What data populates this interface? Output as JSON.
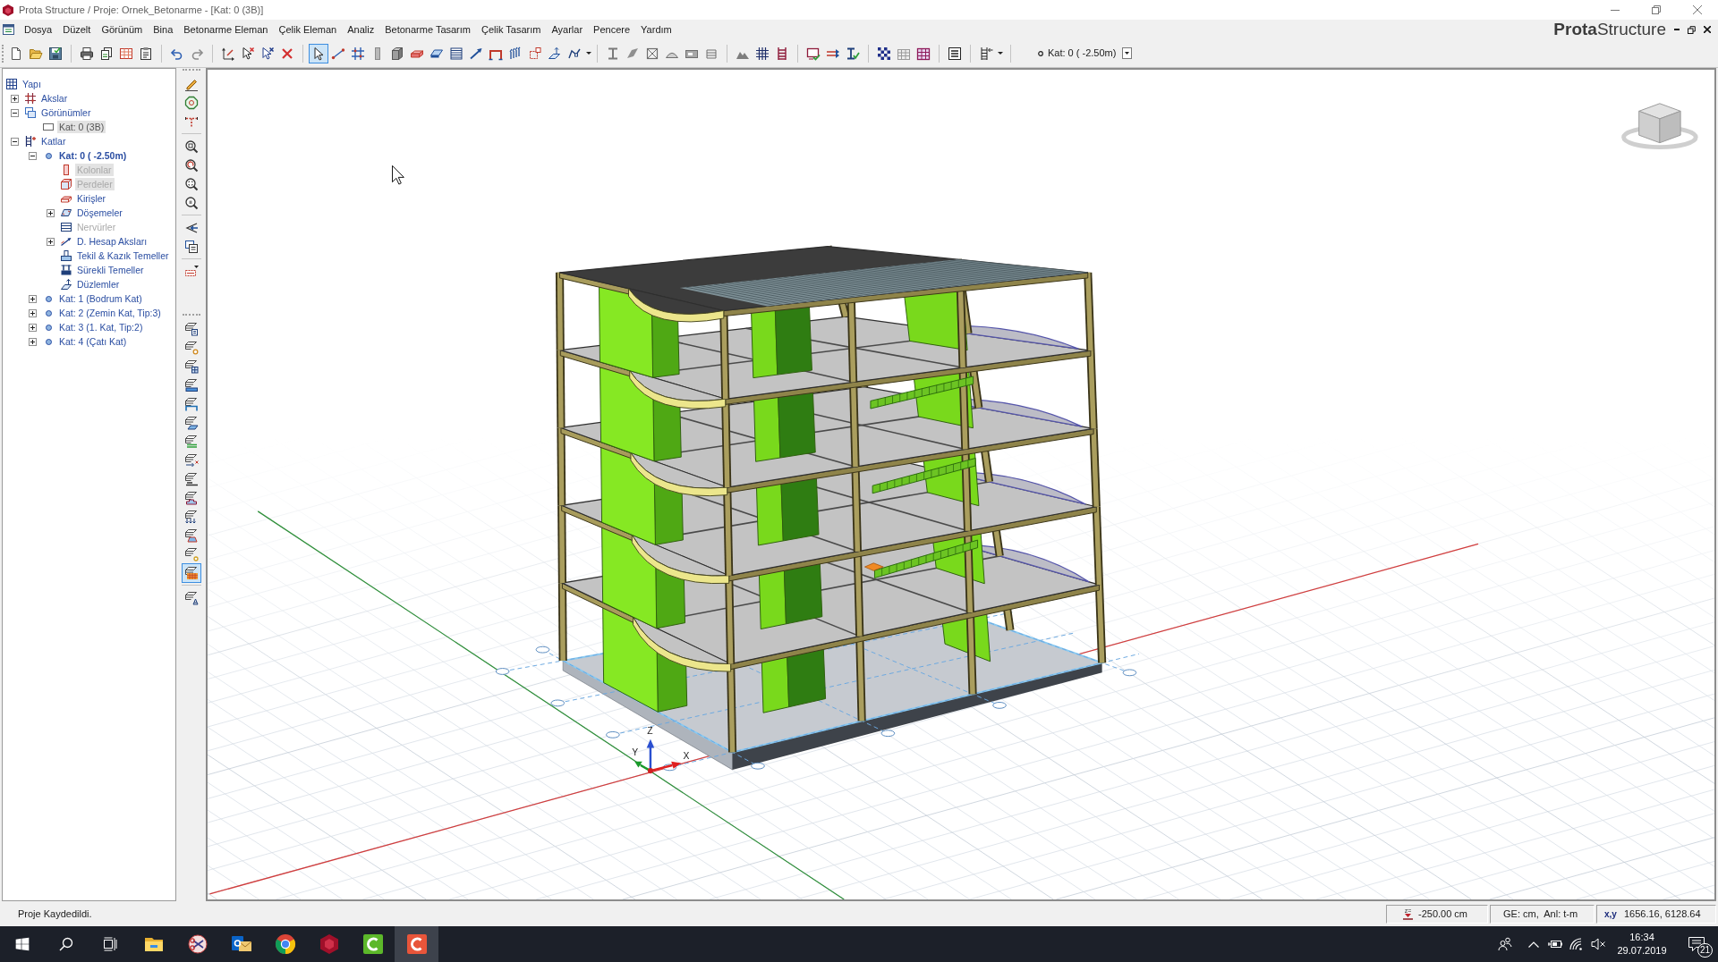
{
  "window": {
    "title": "Prota Structure / Proje: Ornek_Betonarme - [Kat: 0 (3B)]"
  },
  "menu": {
    "items": [
      "Dosya",
      "Düzelt",
      "Görünüm",
      "Bina",
      "Betonarme Eleman",
      "Çelik Eleman",
      "Analiz",
      "Betonarme Tasarım",
      "Çelik Tasarım",
      "Ayarlar",
      "Pencere",
      "Yardım"
    ],
    "logo": "**Prota**Structure"
  },
  "toolbar": {
    "groups": [
      {
        "buttons": [
          {
            "selected": false
          },
          {
            "selected": false
          },
          {
            "selected": false
          }
        ]
      },
      {
        "buttons": [
          {
            "selected": false
          },
          {
            "selected": false
          },
          {
            "selected": false
          },
          {
            "selected": false
          }
        ]
      },
      {
        "buttons": [
          {
            "selected": false
          },
          {
            "selected": false
          }
        ]
      },
      {
        "buttons": [
          {
            "selected": false
          },
          {
            "selected": false
          },
          {
            "selected": false
          },
          {
            "selected": false
          }
        ]
      },
      {
        "buttons": [
          {
            "selected": true
          },
          {
            "selected": false
          },
          {
            "selected": false
          },
          {
            "selected": false
          },
          {
            "selected": false
          },
          {
            "selected": false
          },
          {
            "selected": false
          },
          {
            "selected": false
          },
          {
            "selected": false
          },
          {
            "selected": false
          },
          {
            "selected": false
          },
          {
            "selected": false
          },
          {
            "selected": false
          },
          {
            "selected": false
          }
        ]
      },
      {
        "buttons": [
          {
            "selected": false
          },
          {
            "selected": false
          },
          {
            "selected": false
          },
          {
            "selected": false
          },
          {
            "selected": false
          },
          {
            "selected": false
          }
        ]
      },
      {
        "buttons": [
          {
            "selected": false
          },
          {
            "selected": false
          },
          {
            "selected": false
          }
        ]
      },
      {
        "buttons": [
          {
            "selected": false
          },
          {
            "selected": false
          },
          {
            "selected": false
          }
        ]
      },
      {
        "buttons": [
          {
            "selected": false
          },
          {
            "selected": false
          },
          {
            "selected": false
          }
        ]
      },
      {
        "buttons": [
          {
            "selected": false
          }
        ]
      },
      {
        "buttons": [
          {
            "selected": false
          }
        ]
      }
    ],
    "floor_selector": {
      "value": "Kat: 0 ( -2.50m)"
    }
  },
  "tree": [
    {
      "label": "Yapı",
      "kind": "structure",
      "selected": false,
      "disabled": false,
      "children": [
        {
          "label": "Akslar",
          "kind": "axes",
          "expanded": false,
          "selected": false,
          "disabled": false
        },
        {
          "label": "Görünümler",
          "kind": "views",
          "expanded": true,
          "selected": false,
          "disabled": false,
          "children": [
            {
              "label": "Kat: 0 (3B)",
              "kind": "view",
              "selected": true,
              "disabled": false
            }
          ]
        },
        {
          "label": "Katlar",
          "kind": "floors",
          "expanded": true,
          "selected": false,
          "disabled": false,
          "children": [
            {
              "label": "Kat: 0 ( -2.50m)",
              "kind": "floor",
              "expanded": true,
              "current": true,
              "selected": false,
              "disabled": false,
              "children": [
                {
                  "label": "Kolonlar",
                  "kind": "column",
                  "selected": true,
                  "disabled": true
                },
                {
                  "label": "Perdeler",
                  "kind": "wall",
                  "selected": true,
                  "disabled": true
                },
                {
                  "label": "Kirişler",
                  "kind": "beam",
                  "selected": false,
                  "disabled": false
                },
                {
                  "label": "Döşemeler",
                  "kind": "slab",
                  "expanded": false,
                  "selected": false,
                  "disabled": false
                },
                {
                  "label": "Nervürler",
                  "kind": "rib",
                  "selected": false,
                  "disabled": true
                },
                {
                  "label": "D. Hesap Aksları",
                  "kind": "calc-axis",
                  "expanded": false,
                  "selected": false,
                  "disabled": false
                },
                {
                  "label": "Tekil & Kazık Temeller",
                  "kind": "pad-footing",
                  "selected": false,
                  "disabled": false
                },
                {
                  "label": "Sürekli Temeller",
                  "kind": "strip-footing",
                  "selected": false,
                  "disabled": false
                },
                {
                  "label": "Düzlemler",
                  "kind": "plane",
                  "selected": false,
                  "disabled": false
                }
              ]
            },
            {
              "label": "Kat: 1 (Bodrum Kat)",
              "kind": "floor",
              "expanded": false,
              "current": false,
              "selected": false,
              "disabled": false
            },
            {
              "label": "Kat: 2 (Zemin Kat, Tip:3)",
              "kind": "floor",
              "expanded": false,
              "current": false,
              "selected": false,
              "disabled": false
            },
            {
              "label": "Kat: 3 (1. Kat, Tip:2)",
              "kind": "floor",
              "expanded": false,
              "current": false,
              "selected": false,
              "disabled": false
            },
            {
              "label": "Kat: 4 (Çatı Kat)",
              "kind": "floor",
              "expanded": false,
              "current": false,
              "selected": false,
              "disabled": false
            }
          ]
        }
      ]
    }
  ],
  "side_toolbar": {
    "groups": [
      {
        "buttons": [
          {
            "selected": false
          },
          {
            "selected": false
          },
          {
            "selected": false
          }
        ]
      },
      {
        "buttons": [
          {
            "selected": false
          },
          {
            "selected": false
          },
          {
            "selected": false
          },
          {
            "selected": false
          }
        ]
      },
      {
        "buttons": [
          {
            "selected": false
          },
          {
            "selected": false
          }
        ]
      },
      {
        "buttons": [
          {
            "selected": false
          }
        ]
      },
      {
        "buttons": [
          {
            "selected": false
          },
          {
            "selected": false
          },
          {
            "selected": false
          },
          {
            "selected": false
          },
          {
            "selected": false
          },
          {
            "selected": false
          },
          {
            "selected": false
          },
          {
            "selected": false
          },
          {
            "selected": false
          },
          {
            "selected": false
          },
          {
            "selected": false
          },
          {
            "selected": false
          },
          {
            "selected": false
          },
          {
            "selected": true
          }
        ]
      },
      {
        "buttons": [
          {
            "selected": false
          }
        ]
      }
    ]
  },
  "viewport": {
    "axis_labels": [
      "Z",
      "Y",
      "X"
    ]
  },
  "status_bar": {
    "message": "Proje Kaydedildi.",
    "z_label": "z=",
    "elevation": "-250.00 cm",
    "units": "GE: cm,  Anl: t-m",
    "coords_label": "x,y",
    "coords": "1656.16, 6128.64"
  },
  "taskbar": {
    "apps": [
      {
        "selected": false
      },
      {
        "selected": false
      },
      {
        "selected": false
      },
      {
        "selected": false
      },
      {
        "selected": false
      },
      {
        "selected": false
      },
      {
        "selected": true
      }
    ],
    "clock": {
      "time": "16:34",
      "date": "29.07.2019"
    },
    "notification_count": "21"
  }
}
